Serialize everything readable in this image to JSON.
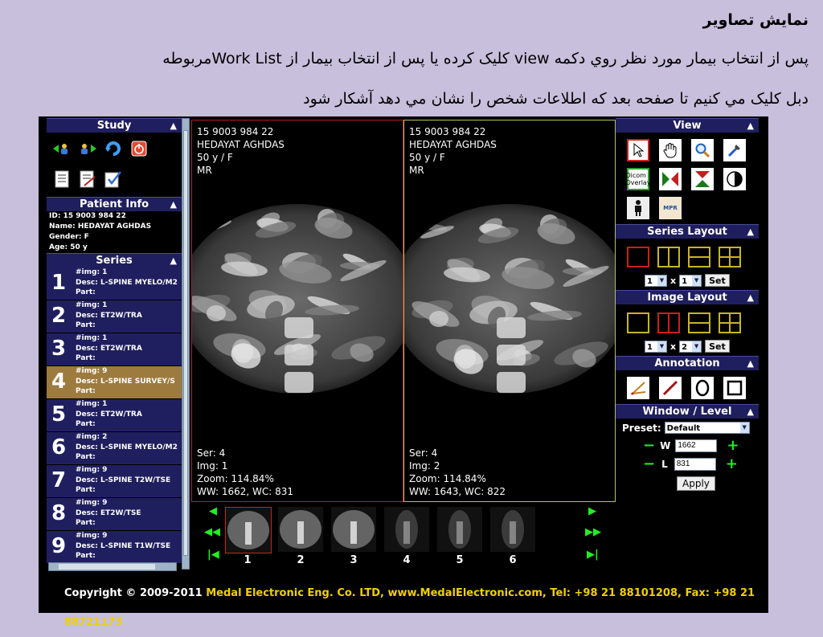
{
  "slide": {
    "title": "نمایش تصاویر",
    "line1": "پس از انتخاب بیمار مورد نظر روي دکمه view کلیک کرده یا پس از انتخاب بیمار از Work Listمربوطه",
    "line2": "دبل کلیک مي کنیم تا صفحه بعد که اطلاعات شخص را نشان مي دهد آشکار شود"
  },
  "study": {
    "header": "Study",
    "icons": [
      "prev-patient-icon",
      "next-patient-icon",
      "refresh-icon",
      "power-icon",
      "report-icon",
      "edit-report-icon",
      "checklist-icon"
    ]
  },
  "patient_info": {
    "header": "Patient Info",
    "id": "ID: 15 9003 984 22",
    "name": "Name: HEDAYAT AGHDAS",
    "gender": "Gender: F",
    "age": "Age: 50 y"
  },
  "series": {
    "header": "Series",
    "items": [
      {
        "num": "1",
        "img": "#img: 1",
        "desc": "Desc: L-SPINE MYELO/M2",
        "part": "Part:"
      },
      {
        "num": "2",
        "img": "#img: 1",
        "desc": "Desc: ET2W/TRA",
        "part": "Part:"
      },
      {
        "num": "3",
        "img": "#img: 1",
        "desc": "Desc: ET2W/TRA",
        "part": "Part:"
      },
      {
        "num": "4",
        "img": "#img: 9",
        "desc": "Desc: L-SPINE SURVEY/S",
        "part": "Part:"
      },
      {
        "num": "5",
        "img": "#img: 1",
        "desc": "Desc: ET2W/TRA",
        "part": "Part:"
      },
      {
        "num": "6",
        "img": "#img: 2",
        "desc": "Desc: L-SPINE MYELO/M2",
        "part": "Part:"
      },
      {
        "num": "7",
        "img": "#img: 9",
        "desc": "Desc: L-SPINE T2W/TSE",
        "part": "Part:"
      },
      {
        "num": "8",
        "img": "#img: 9",
        "desc": "Desc: ET2W/TSE",
        "part": "Part:"
      },
      {
        "num": "9",
        "img": "#img: 9",
        "desc": "Desc: L-SPINE T1W/TSE",
        "part": "Part:"
      }
    ],
    "active_index": 3
  },
  "viewports": [
    {
      "patient_id": "15 9003 984 22",
      "name": "HEDAYAT AGHDAS",
      "age_sex": "50 y / F",
      "modality": "MR",
      "ser": "Ser: 4",
      "img": "Img: 1",
      "zoom": "Zoom: 114.84%",
      "wwwc": "WW: 1662, WC: 831"
    },
    {
      "patient_id": "15 9003 984 22",
      "name": "HEDAYAT AGHDAS",
      "age_sex": "50 y / F",
      "modality": "MR",
      "ser": "Ser: 4",
      "img": "Img: 2",
      "zoom": "Zoom: 114.84%",
      "wwwc": "WW: 1643, WC: 822"
    }
  ],
  "thumbnails": {
    "labels": [
      "1",
      "2",
      "3",
      "4",
      "5",
      "6"
    ],
    "selected_index": 0,
    "arrows": {
      "prev": "◀",
      "prev_fast": "◀◀",
      "first": "|◀",
      "next": "▶",
      "next_fast": "▶▶",
      "last": "▶|"
    }
  },
  "view": {
    "header": "View",
    "tools": [
      "pointer-icon",
      "pan-hand-icon",
      "zoom-icon",
      "window-level-icon",
      "dicom-overlay-icon",
      "flip-horizontal-icon",
      "flip-vertical-icon",
      "invert-icon",
      "body-orientation-icon",
      "mpr-icon"
    ],
    "dicom_overlay_label": "Dicom Overlay",
    "mpr_label": "MPR"
  },
  "series_layout": {
    "header": "Series Layout",
    "rows": "1",
    "x": "x",
    "cols": "1",
    "set": "Set",
    "selected_index": 0
  },
  "image_layout": {
    "header": "Image Layout",
    "rows": "1",
    "x": "x",
    "cols": "2",
    "set": "Set",
    "selected_index": 1
  },
  "annotation": {
    "header": "Annotation",
    "tools": [
      "angle-icon",
      "ruler-icon",
      "ellipse-icon",
      "rectangle-icon"
    ]
  },
  "window_level": {
    "header": "Window / Level",
    "preset_label": "Preset:",
    "preset_value": "Default",
    "w_label": "W",
    "w_value": "1662",
    "l_label": "L",
    "l_value": "831",
    "minus": "−",
    "plus": "+",
    "apply": "Apply"
  },
  "footer": {
    "copyright": "Copyright © 2009-2011",
    "company": "Medal Electronic Eng. Co. LTD, www.MedalElectronic.com, Tel: +98 21 88101208, Fax: +98 21 88721173"
  },
  "colors": {
    "panel_header": "#1f1f5f",
    "active_series": "#9d7b3e",
    "accent_green": "#22ee22",
    "footer_yellow": "#f0d000"
  }
}
